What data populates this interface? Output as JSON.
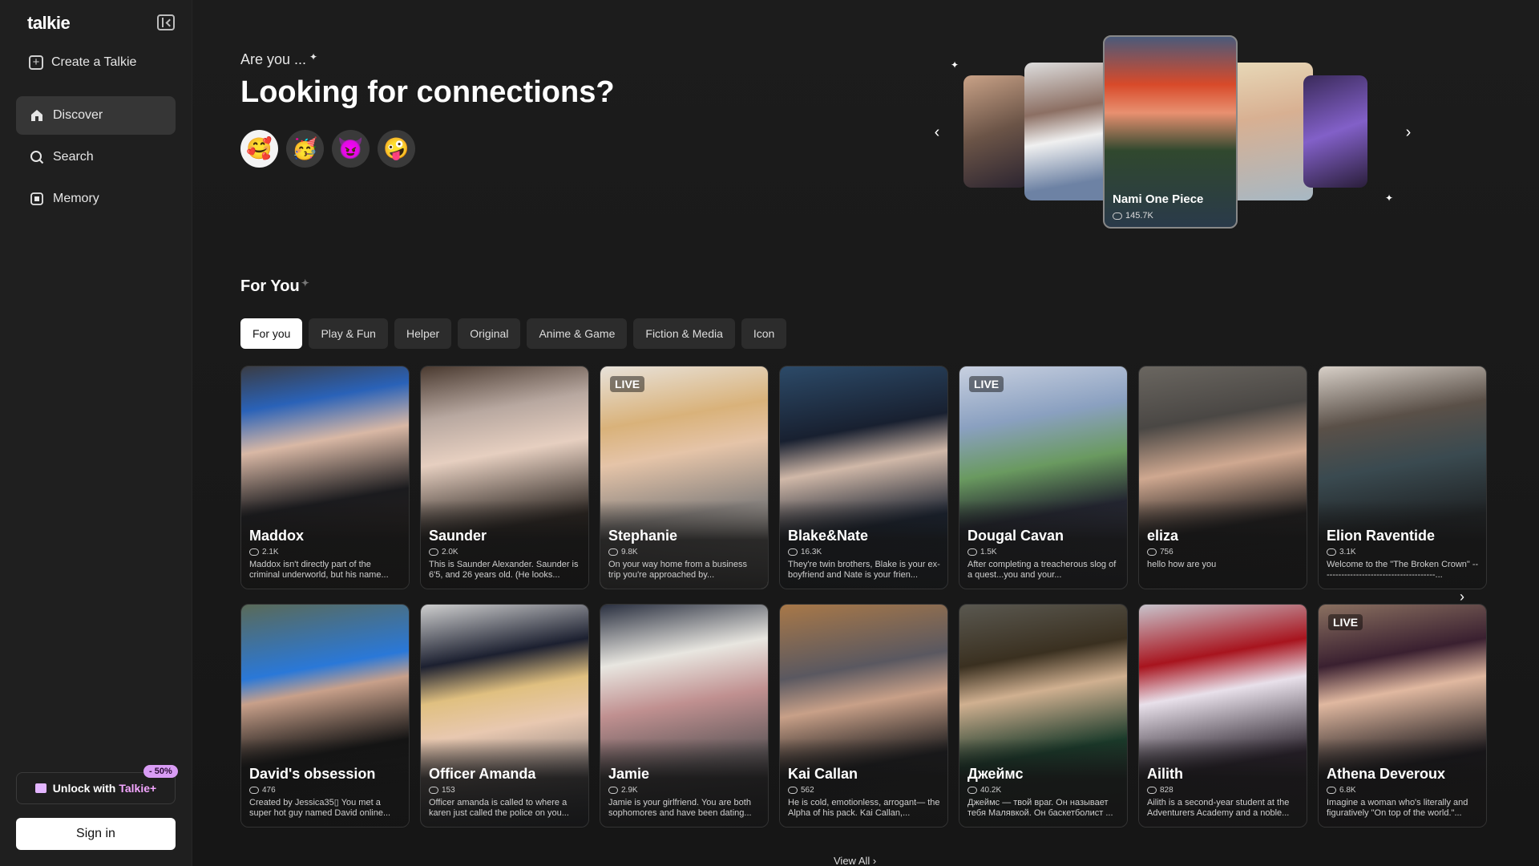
{
  "app": {
    "logo": "talkie"
  },
  "sidebar": {
    "create": "Create a Talkie",
    "items": [
      {
        "label": "Discover",
        "icon": "home-icon"
      },
      {
        "label": "Search",
        "icon": "search-icon"
      },
      {
        "label": "Memory",
        "icon": "memory-icon"
      }
    ],
    "unlock_prefix": "Unlock with",
    "unlock_brand": "Talkie+",
    "discount_badge": "- 50%",
    "sign_in": "Sign in"
  },
  "hero": {
    "subtitle": "Are you ...",
    "title": "Looking for connections?",
    "emojis": [
      "🥰",
      "🥳",
      "😈",
      "🤪"
    ]
  },
  "carousel": {
    "featured_name": "Nami One Piece",
    "featured_count": "145.7K"
  },
  "section": {
    "title": "For You",
    "tabs": [
      "For you",
      "Play & Fun",
      "Helper",
      "Original",
      "Anime & Game",
      "Fiction & Media",
      "Icon"
    ]
  },
  "cards": [
    {
      "name": "Maddox",
      "count": "2.1K",
      "desc": "Maddox isn't directly part of the criminal underworld, but his name...",
      "live": "",
      "bg": "linear-gradient(170deg,#3a3c44 0%,#2a62b8 18%,#d9b8a5 35%,#1b1b1e 60%,#30251e 100%)"
    },
    {
      "name": "Saunder",
      "count": "2.0K",
      "desc": "This is Saunder Alexander. Saunder is 6'5, and 26 years old. (He looks...",
      "live": "",
      "bg": "linear-gradient(170deg,#4a3a30 0%,#b8a8a0 22%,#e6cfc0 40%,#2a2420 70%,#1b1817 100%)"
    },
    {
      "name": "Stephanie",
      "count": "9.8K",
      "desc": "On your way home from a business trip you're approached by...",
      "live": "LIVE",
      "bg": "linear-gradient(170deg,#e8e2da 0%,#d9b27a 25%,#e5c4a8 40%,#8a8480 65%,#cfc8c0 100%)"
    },
    {
      "name": "Blake&Nate",
      "count": "16.3K",
      "desc": "They're twin brothers, Blake is your ex-boyfriend and Nate is your frien...",
      "live": "",
      "bg": "linear-gradient(170deg,#2c4a68 0%,#182030 30%,#d0b8a8 45%,#1a2230 70%,#203048 100%)"
    },
    {
      "name": "Dougal Cavan",
      "count": "1.5K",
      "desc": "After completing a treacherous slog of a quest...you and your...",
      "live": "LIVE",
      "bg": "linear-gradient(170deg,#c8d0e0 0%,#8aa0c0 25%,#6a9a60 45%,#232530 65%,#3a3a48 100%)"
    },
    {
      "name": "eliza",
      "count": "756",
      "desc": "hello how are you",
      "live": "",
      "bg": "linear-gradient(170deg,#6a6660 0%,#4a4744 25%,#cfa890 45%,#1e1c1c 70%,#262424 100%)"
    },
    {
      "name": "Elion Raventide",
      "count": "3.1K",
      "desc": "Welcome to the \"The Broken Crown\" ---------------------------------------...",
      "live": "",
      "bg": "linear-gradient(170deg,#d8d0c8 0%,#5a5048 25%,#3a4a50 45%,#1f2224 70%,#2a2a2a 100%)"
    },
    {
      "name": "David's obsession",
      "count": "476",
      "desc": "Created by Jessica35▯ You met a super hot guy named David online...",
      "live": "",
      "bg": "linear-gradient(170deg,#5a6a58 0%,#2a78d8 30%,#c8a08a 40%,#141414 65%,#202020 100%)"
    },
    {
      "name": "Officer Amanda",
      "count": "153",
      "desc": "Officer amanda is called to where a karen just called the police on you...",
      "live": "",
      "bg": "linear-gradient(170deg,#cfcfcf 0%,#1c2030 25%,#e0c080 40%,#e8c8b0 55%,#2a3448 100%)"
    },
    {
      "name": "Jamie",
      "count": "2.9K",
      "desc": "Jamie is your girlfriend. You are both sophomores and have been dating...",
      "live": "",
      "bg": "linear-gradient(170deg,#2a3040 0%,#e8e6e0 25%,#c09090 45%,#60585a 70%,#2a2a30 100%)"
    },
    {
      "name": "Kai Callan",
      "count": "562",
      "desc": "He is cold, emotionless, arrogant— the Alpha of his pack. Kai Callan,...",
      "live": "",
      "bg": "linear-gradient(170deg,#a87848 0%,#5a5860 30%,#c8a088 45%,#1a1a1c 70%,#2a2a2a 100%)"
    },
    {
      "name": "Джеймс",
      "count": "40.2K",
      "desc": "Джеймс — твой враг. Он называет тебя Малявкой. Он баскетболист ...",
      "live": "",
      "bg": "linear-gradient(170deg,#5a5850 0%,#3a3020 25%,#d0b090 40%,#1a3a2a 65%,#2a2a2a 100%)"
    },
    {
      "name": "Ailith",
      "count": "828",
      "desc": "Ailith is a second-year student at the Adventurers Academy and a noble...",
      "live": "",
      "bg": "linear-gradient(170deg,#c8c4cc 0%,#a8141e 25%,#e8e0ea 40%,#28202a 70%,#3a3038 100%)"
    },
    {
      "name": "Athena Deveroux",
      "count": "6.8K",
      "desc": "Imagine a woman who's literally and figuratively \"On top of the world.\"...",
      "live": "LIVE",
      "bg": "linear-gradient(170deg,#8a7060 0%,#3a2030 25%,#e0b8a0 40%,#18161a 70%,#2a2024 100%)"
    }
  ],
  "view_all": "View All"
}
